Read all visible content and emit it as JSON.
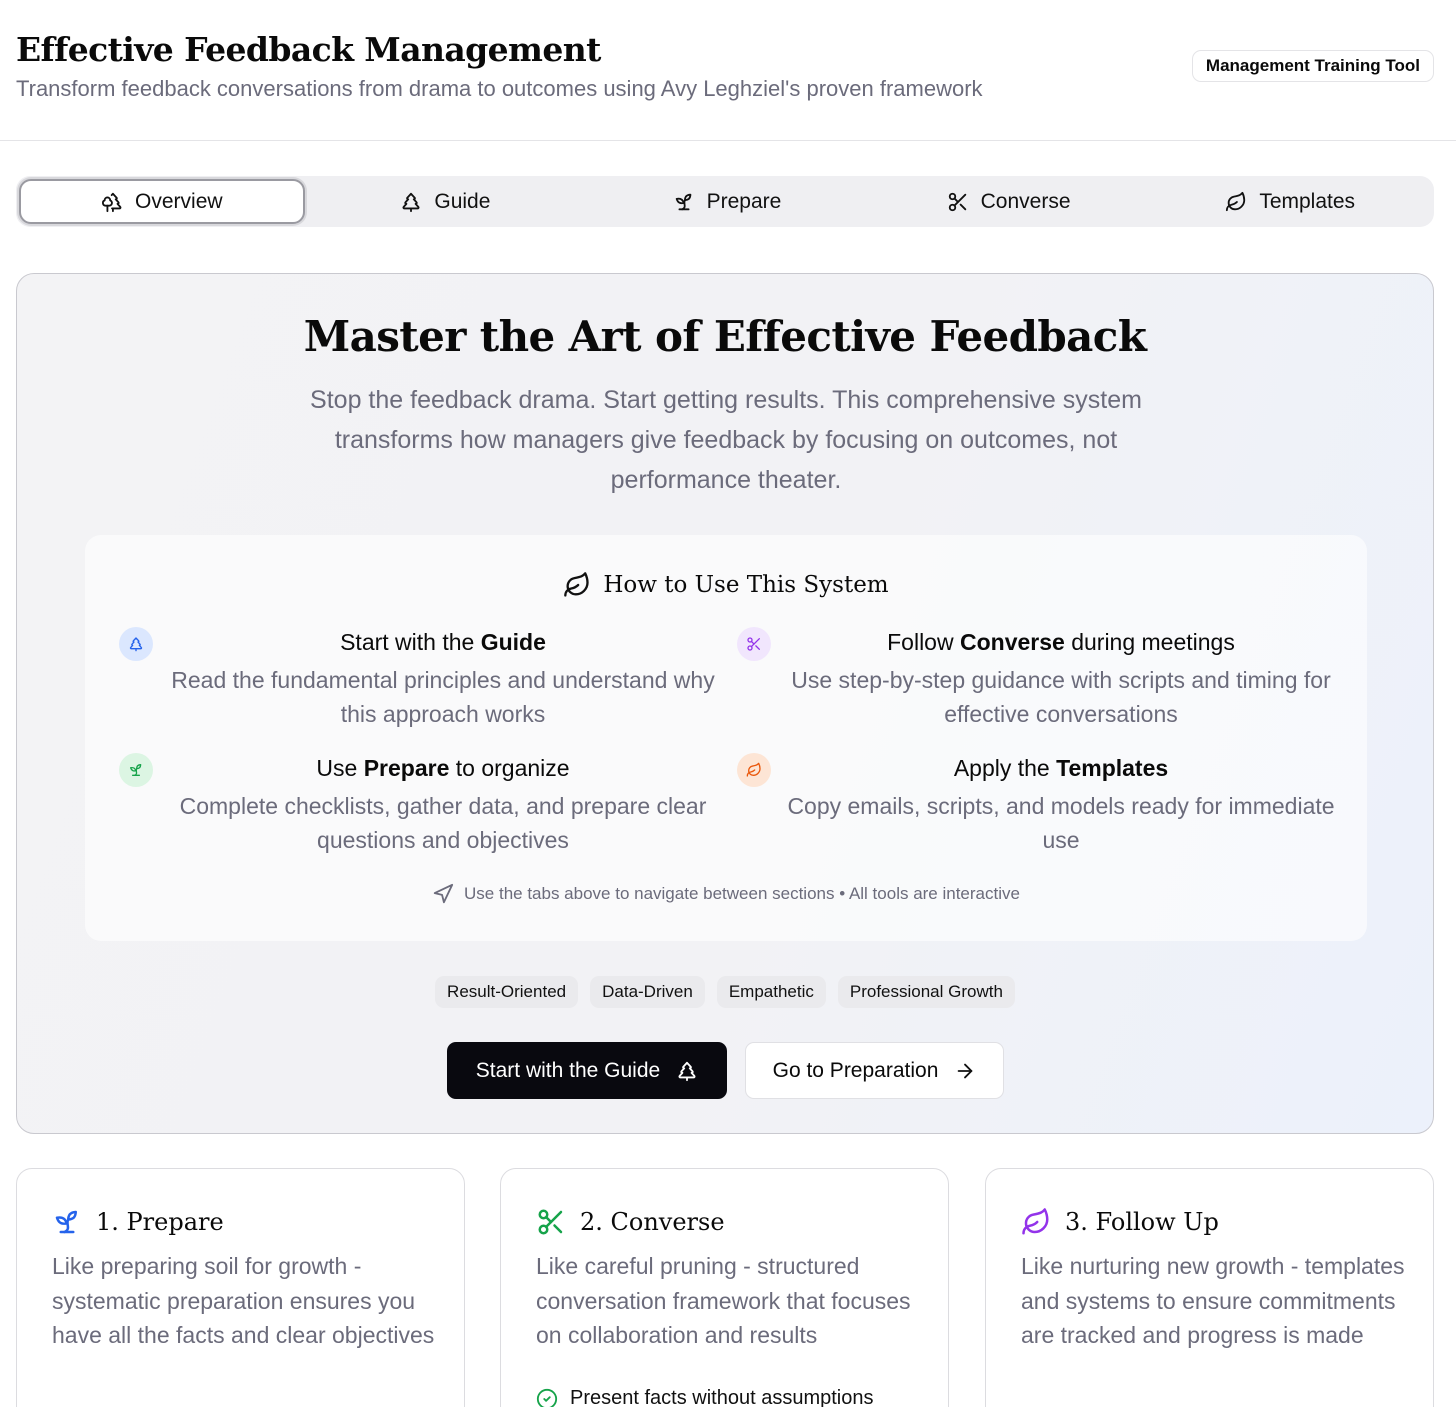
{
  "header": {
    "title": "Effective Feedback Management",
    "subtitle": "Transform feedback conversations from drama to outcomes using Avy Leghziel's proven framework",
    "badge": "Management Training Tool"
  },
  "tabs": [
    {
      "label": "Overview",
      "icon": "trees-icon",
      "active": true
    },
    {
      "label": "Guide",
      "icon": "tree-icon",
      "active": false
    },
    {
      "label": "Prepare",
      "icon": "sprout-icon",
      "active": false
    },
    {
      "label": "Converse",
      "icon": "scissors-icon",
      "active": false
    },
    {
      "label": "Templates",
      "icon": "leaf-icon",
      "active": false
    }
  ],
  "hero": {
    "title": "Master the Art of Effective Feedback",
    "text": "Stop the feedback drama. Start getting results. This comprehensive system transforms how managers give feedback by focusing on outcomes, not performance theater.",
    "howto": {
      "title": "How to Use This System",
      "steps": [
        {
          "pre": "Start with the ",
          "bold": "Guide",
          "post": "",
          "desc": "Read the fundamental principles and understand why this approach works",
          "icon": "tree-icon",
          "color": "#2563eb",
          "bg": "#dbe7fe"
        },
        {
          "pre": "Follow ",
          "bold": "Converse",
          "post": " during meetings",
          "desc": "Use step-by-step guidance with scripts and timing for effective conversations",
          "icon": "scissors-icon",
          "color": "#9333ea",
          "bg": "#f1e6fd"
        },
        {
          "pre": "Use ",
          "bold": "Prepare",
          "post": " to organize",
          "desc": "Complete checklists, gather data, and prepare clear questions and objectives",
          "icon": "sprout-icon",
          "color": "#16a34a",
          "bg": "#dcf5e3"
        },
        {
          "pre": "Apply the ",
          "bold": "Templates",
          "post": "",
          "desc": "Copy emails, scripts, and models ready for immediate use",
          "icon": "leaf-icon",
          "color": "#ea580c",
          "bg": "#fde5d5"
        }
      ],
      "footer": "Use the tabs above to navigate between sections • All tools are interactive"
    },
    "chips": [
      "Result-Oriented",
      "Data-Driven",
      "Empathetic",
      "Professional Growth"
    ],
    "primary_button": "Start with the Guide",
    "secondary_button": "Go to Preparation"
  },
  "cards": [
    {
      "title": "1. Prepare",
      "text": "Like preparing soil for growth - systematic preparation ensures you have all the facts and clear objectives",
      "icon": "sprout-icon",
      "color": "#2563eb"
    },
    {
      "title": "2. Converse",
      "text": "Like careful pruning - structured conversation framework that focuses on collaboration and results",
      "icon": "scissors-icon",
      "color": "#16a34a",
      "check": "Present facts without assumptions"
    },
    {
      "title": "3. Follow Up",
      "text": "Like nurturing new growth - templates and systems to ensure commitments are tracked and progress is made",
      "icon": "leaf-icon",
      "color": "#9333ea"
    }
  ]
}
